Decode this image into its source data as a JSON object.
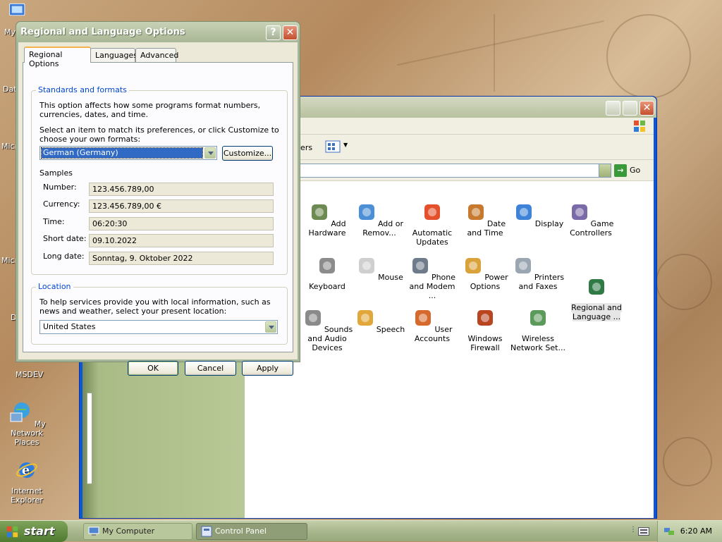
{
  "desktop": {
    "icons": [
      {
        "label": "My",
        "icon": "my-documents-icon"
      },
      {
        "label": "Dat",
        "icon": "folder-icon"
      },
      {
        "label": "Micr",
        "icon": "shortcut-icon"
      },
      {
        "label": "Micr",
        "icon": "shortcut-icon"
      },
      {
        "label": "D",
        "icon": "shortcut-icon"
      },
      {
        "label": "MSDEV",
        "icon": "folder-icon"
      },
      {
        "label": "My Network Places",
        "icon": "network-places-icon"
      },
      {
        "label": "Internet Explorer",
        "icon": "internet-explorer-icon"
      }
    ]
  },
  "control_panel": {
    "toolbar_text": "lers",
    "go_label": "Go",
    "items": [
      {
        "label": "Add Hardware",
        "icon": "add-hardware-icon"
      },
      {
        "label": "Add or Remov...",
        "icon": "add-remove-programs-icon"
      },
      {
        "label": "Automatic Updates",
        "icon": "automatic-updates-icon"
      },
      {
        "label": "Date and Time",
        "icon": "date-time-icon"
      },
      {
        "label": "Display",
        "icon": "display-icon"
      },
      {
        "label": "Game Controllers",
        "icon": "game-controllers-icon"
      },
      {
        "label": "Keyboard",
        "icon": "keyboard-icon"
      },
      {
        "label": "Mouse",
        "icon": "mouse-icon"
      },
      {
        "label": "Phone and Modem ...",
        "icon": "phone-modem-icon"
      },
      {
        "label": "Power Options",
        "icon": "power-options-icon"
      },
      {
        "label": "Printers and Faxes",
        "icon": "printers-faxes-icon"
      },
      {
        "label": "Regional and Language ...",
        "icon": "regional-language-icon"
      },
      {
        "label": "Sounds and Audio Devices",
        "icon": "sounds-audio-icon"
      },
      {
        "label": "Speech",
        "icon": "speech-icon"
      },
      {
        "label": "User Accounts",
        "icon": "user-accounts-icon"
      },
      {
        "label": "Windows Firewall",
        "icon": "windows-firewall-icon"
      },
      {
        "label": "Wireless Network Set...",
        "icon": "wireless-network-icon"
      }
    ]
  },
  "dialog": {
    "title": "Regional and Language Options",
    "help_glyph": "?",
    "close_glyph": "✕",
    "tabs": [
      "Regional Options",
      "Languages",
      "Advanced"
    ],
    "standards": {
      "title": "Standards and formats",
      "desc": "This option affects how some programs format numbers, currencies, dates, and time.",
      "select_prompt": "Select an item to match its preferences, or click Customize to choose your own formats:",
      "selected_locale": "German (Germany)",
      "customize_label": "Customize...",
      "samples_title": "Samples",
      "samples": [
        {
          "label": "Number:",
          "value": "123.456.789,00"
        },
        {
          "label": "Currency:",
          "value": "123.456.789,00 €"
        },
        {
          "label": "Time:",
          "value": "06:20:30"
        },
        {
          "label": "Short date:",
          "value": "09.10.2022"
        },
        {
          "label": "Long date:",
          "value": "Sonntag, 9. Oktober 2022"
        }
      ]
    },
    "location": {
      "title": "Location",
      "desc": "To help services provide you with local information, such as news and weather, select your present location:",
      "selected": "United States"
    },
    "buttons": {
      "ok": "OK",
      "cancel": "Cancel",
      "apply": "Apply"
    }
  },
  "taskbar": {
    "start_label": "start",
    "tasks": [
      {
        "label": "My Computer",
        "active": false
      },
      {
        "label": "Control Panel",
        "active": true
      }
    ],
    "clock": "6:20 AM"
  }
}
